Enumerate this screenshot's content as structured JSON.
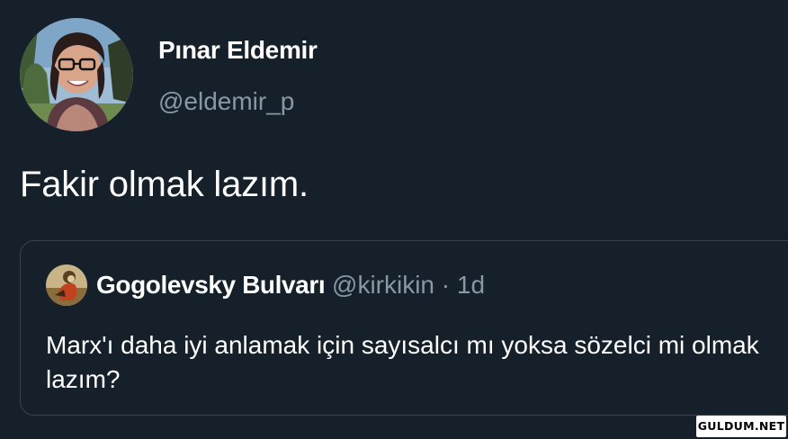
{
  "tweet": {
    "author_name": "Pınar Eldemir",
    "author_handle": "@eldemir_p",
    "text": "Fakir olmak lazım."
  },
  "quoted_tweet": {
    "author_name": "Gogolevsky Bulvarı",
    "author_handle": "@kirkikin",
    "separator": "·",
    "time": "1d",
    "text": "Marx'ı daha iyi anlamak için sayısalcı mı yoksa sözelci mi olmak lazım?"
  },
  "watermark": "GULDUM.NET",
  "colors": {
    "background": "#15202b",
    "primary_text": "#ffffff",
    "secondary_text": "#8899a6",
    "border": "#38444d"
  }
}
